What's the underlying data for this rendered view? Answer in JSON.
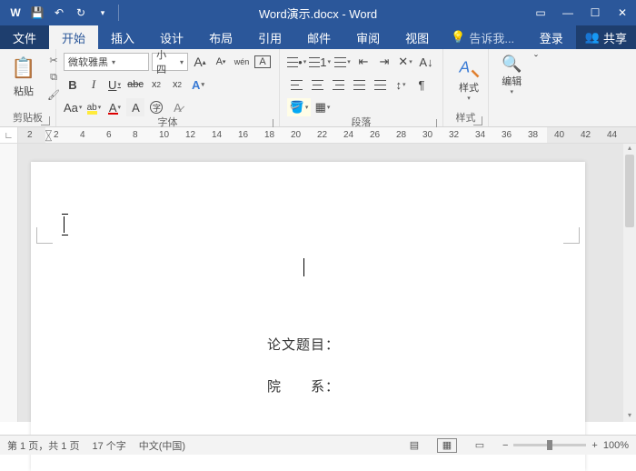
{
  "title": "Word演示.docx - Word",
  "qat": {
    "word": "W",
    "save": "💾",
    "undo": "↶",
    "redo": "↷"
  },
  "menu": {
    "file": "文件",
    "tabs": [
      "开始",
      "插入",
      "设计",
      "布局",
      "引用",
      "邮件",
      "审阅",
      "视图"
    ],
    "active_index": 0,
    "tell_me": "告诉我...",
    "login": "登录",
    "share": "共享"
  },
  "ribbon": {
    "clipboard": {
      "paste": "粘贴",
      "label": "剪贴板"
    },
    "font": {
      "name": "微软雅黑",
      "size": "小四",
      "bold": "B",
      "italic": "I",
      "underline": "U",
      "strike": "abc",
      "sub": "x₂",
      "sup": "x²",
      "grow": "A",
      "shrink": "A",
      "clear": "Aa",
      "wen": "wén",
      "box_a": "A",
      "phonetic": "A",
      "char_border": "A",
      "text_effects": "A",
      "highlight": "ab",
      "font_color": "A",
      "char_shading": "A",
      "enclose": "字",
      "label": "字体"
    },
    "para": {
      "label": "段落"
    },
    "styles": {
      "btn": "样式",
      "label": "样式"
    },
    "edit": {
      "btn": "编辑"
    }
  },
  "ruler": {
    "labels": [
      "2",
      "2",
      "4",
      "6",
      "8",
      "10",
      "12",
      "14",
      "16",
      "18",
      "20",
      "22",
      "24",
      "26",
      "28",
      "30",
      "32",
      "34",
      "36",
      "38",
      "40",
      "42",
      "44"
    ]
  },
  "doc": {
    "line1": "论文题目：",
    "line2": "院　　系："
  },
  "status": {
    "page": "第 1 页，共 1 页",
    "words": "17 个字",
    "lang": "中文(中国)",
    "zoom": "100%"
  }
}
